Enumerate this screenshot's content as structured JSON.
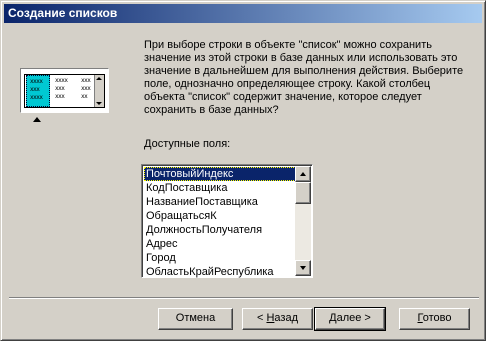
{
  "window": {
    "title": "Создание списков"
  },
  "preview": {
    "col1": "xxxx\nxxx\nxxxx",
    "col2": "xxxx\nxxx\nxxx",
    "col3": "xxx\nxxx\nxx"
  },
  "description": "При выборе строки в объекте \"список\" можно сохранить\nзначение из этой строки в базе данных или использовать это\nзначение в дальнейшем для выполнения действия.  Выберите\nполе, однозначно определяющее строку.  Какой столбец\nобъекта \"список\" содержит значение, которое следует\nсохранить в базе данных?",
  "fields": {
    "label": "Доступные поля:",
    "items": [
      "ПочтовыйИндекс",
      "КодПоставщика",
      "НазваниеПоставщика",
      "ОбращатьсяК",
      "ДолжностьПолучателя",
      "Адрес",
      "Город",
      "ОбластьКрайРеспублика"
    ],
    "selected_index": 0
  },
  "buttons": {
    "cancel": "Отмена",
    "back_prefix": "< ",
    "back_accel": "Н",
    "back_rest": "азад",
    "next_prefix": "",
    "next_accel": "Д",
    "next_rest": "алее >",
    "finish_prefix": "",
    "finish_accel": "Г",
    "finish_rest": "отово"
  }
}
